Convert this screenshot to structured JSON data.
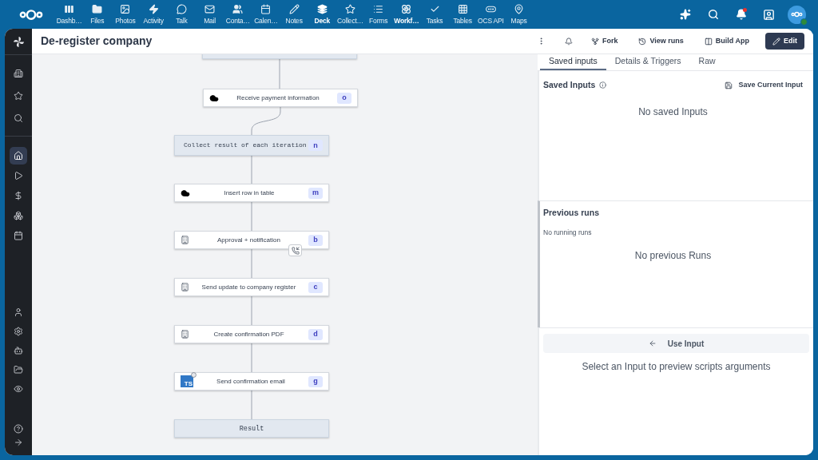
{
  "top_bar": {
    "apps": [
      {
        "label": "Dashb…",
        "active": false
      },
      {
        "label": "Files",
        "active": false
      },
      {
        "label": "Photos",
        "active": false
      },
      {
        "label": "Activity",
        "active": false
      },
      {
        "label": "Talk",
        "active": false
      },
      {
        "label": "Mail",
        "active": false
      },
      {
        "label": "Conta…",
        "active": false
      },
      {
        "label": "Calen…",
        "active": false
      },
      {
        "label": "Notes",
        "active": false
      },
      {
        "label": "Deck",
        "active": true
      },
      {
        "label": "Collect…",
        "active": false
      },
      {
        "label": "Forms",
        "active": false
      },
      {
        "label": "Workf…",
        "active": true
      },
      {
        "label": "Tasks",
        "active": false
      },
      {
        "label": "Tables",
        "active": false
      },
      {
        "label": "OCS API",
        "active": false
      },
      {
        "label": "Maps",
        "active": false
      }
    ],
    "notifications": {
      "unread": true
    },
    "user": {
      "online": true
    }
  },
  "sidebar": {
    "groups": [
      {
        "items": [
          {
            "selected": false
          },
          {
            "selected": false
          },
          {
            "selected": false
          }
        ]
      },
      {
        "items": [
          {
            "selected": true
          },
          {
            "selected": false
          },
          {
            "selected": false
          },
          {
            "selected": false
          },
          {
            "selected": false
          }
        ]
      },
      {
        "items": [
          {
            "selected": false
          },
          {
            "selected": false
          },
          {
            "selected": false
          },
          {
            "selected": false
          },
          {
            "selected": false
          }
        ]
      },
      {
        "items": [
          {
            "selected": false
          },
          {
            "selected": false
          }
        ]
      }
    ]
  },
  "header": {
    "title": "De-register company",
    "actions": [
      {
        "label": "Fork",
        "kind": "ghost"
      },
      {
        "label": "View runs",
        "kind": "ghost"
      },
      {
        "label": "Build App",
        "kind": "ghost"
      },
      {
        "label": "Edit",
        "kind": "primary"
      }
    ]
  },
  "flow": {
    "nodes": [
      {
        "kind": "partial"
      },
      {
        "kind": "step",
        "label": "Receive payment information",
        "badge": "o",
        "approval": false
      },
      {
        "kind": "loop",
        "label": "Collect result of each iteration",
        "badge": "n"
      },
      {
        "kind": "step",
        "label": "Insert row in table",
        "badge": "m",
        "approval": false
      },
      {
        "kind": "step",
        "label": "Approval + notification",
        "badge": "b",
        "approval": true
      },
      {
        "kind": "step",
        "label": "Send update to company register",
        "badge": "c",
        "approval": false
      },
      {
        "kind": "step",
        "label": "Create confirmation PDF",
        "badge": "d",
        "approval": false
      },
      {
        "kind": "step",
        "label": "Send confirmation email",
        "badge": "g",
        "approval": false,
        "logo_text": "TS"
      },
      {
        "kind": "result",
        "label": "Result"
      }
    ]
  },
  "right_panel": {
    "tabs": [
      {
        "label": "Saved inputs",
        "selected": true
      },
      {
        "label": "Details & Triggers",
        "selected": false
      },
      {
        "label": "Raw",
        "selected": false
      }
    ],
    "saved_inputs": {
      "title": "Saved Inputs",
      "save_button": "Save Current Input",
      "empty_text": "No saved Inputs"
    },
    "previous_runs": {
      "title": "Previous runs",
      "running_text": "No running runs",
      "empty_text": "No previous Runs"
    },
    "use_input_button": "Use Input",
    "preview_hint": "Select an Input to preview scripts arguments"
  }
}
